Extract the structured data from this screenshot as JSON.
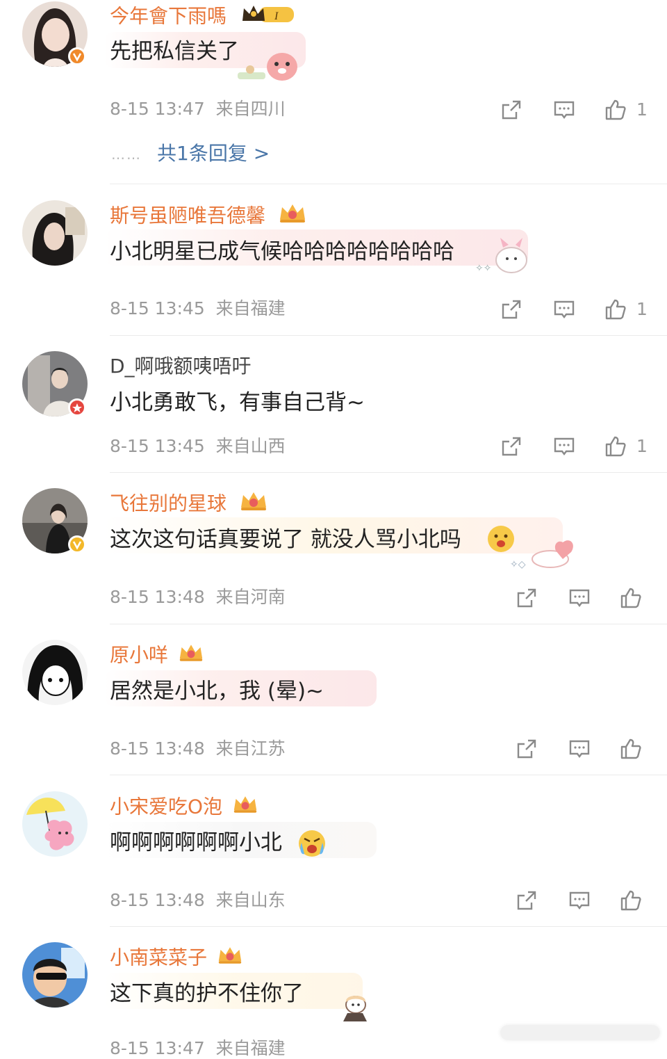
{
  "colors": {
    "username": "#e8773a",
    "link": "#4a76a8",
    "meta": "#9a9a9a"
  },
  "comments": [
    {
      "username": "今年會下雨嗎",
      "text": "先把私信关了",
      "time": "8-15 13:47",
      "location": "来自四川",
      "likes": "1",
      "replies": "共1条回复 >",
      "badge": "vip-crown-level-I"
    },
    {
      "username": "斯号虽陋唯吾德馨",
      "text": "小北明星已成气候哈哈哈哈哈哈哈哈",
      "time": "8-15 13:45",
      "location": "来自福建",
      "likes": "1"
    },
    {
      "username": "D_啊哦额咦唔吁",
      "text": "小北勇敢飞，有事自己背~",
      "time": "8-15 13:45",
      "location": "来自山西",
      "likes": "1"
    },
    {
      "username": "飞往别的星球",
      "text": "这次这句话真要说了 就没人骂小北吗",
      "time": "8-15 13:48",
      "location": "来自河南",
      "likes": ""
    },
    {
      "username": "原小咩",
      "text": "居然是小北，我 (晕)~",
      "time": "8-15 13:48",
      "location": "来自江苏",
      "likes": ""
    },
    {
      "username": "小宋爱吃O泡",
      "text": "啊啊啊啊啊啊小北",
      "time": "8-15 13:48",
      "location": "来自山东",
      "likes": ""
    },
    {
      "username": "小南菜菜子",
      "text": "这下真的护不住你了",
      "time": "8-15 13:47",
      "location": "来自福建",
      "likes": ""
    }
  ],
  "icons": [
    "share-icon",
    "comment-icon",
    "like-icon",
    "crown-icon",
    "verified-icon",
    "vip-crown-icon"
  ]
}
